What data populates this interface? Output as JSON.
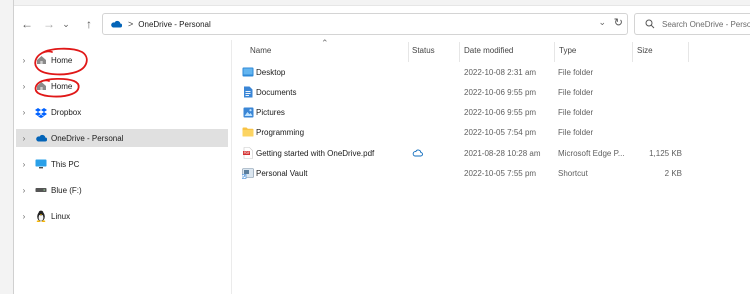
{
  "nav": {
    "back_glyph": "←",
    "forward_glyph": "→",
    "recent_glyph": "⌄",
    "up_glyph": "↑"
  },
  "address": {
    "separator": ">",
    "path": "OneDrive - Personal",
    "dropdown_glyph": "⌄",
    "refresh_glyph": "↻"
  },
  "search": {
    "placeholder": "Search OneDrive - Personal"
  },
  "sidebar": {
    "items": [
      {
        "label": "Home",
        "icon": "home-icon"
      },
      {
        "label": "Home",
        "icon": "home-icon"
      },
      {
        "label": "Dropbox",
        "icon": "dropbox-icon"
      },
      {
        "label": "OneDrive - Personal",
        "icon": "onedrive-cloud-icon",
        "selected": true
      },
      {
        "label": "This PC",
        "icon": "monitor-icon"
      },
      {
        "label": "Blue (F:)",
        "icon": "drive-icon"
      },
      {
        "label": "Linux",
        "icon": "linux-penguin-icon"
      }
    ]
  },
  "columns": {
    "name": "Name",
    "status": "Status",
    "date": "Date modified",
    "type": "Type",
    "size": "Size"
  },
  "files": [
    {
      "name": "Desktop",
      "date": "2022-10-08 2:31 am",
      "type": "File folder",
      "size": "",
      "icon": "desktop-folder-icon",
      "status": ""
    },
    {
      "name": "Documents",
      "date": "2022-10-06 9:55 pm",
      "type": "File folder",
      "size": "",
      "icon": "documents-folder-icon",
      "status": ""
    },
    {
      "name": "Pictures",
      "date": "2022-10-06 9:55 pm",
      "type": "File folder",
      "size": "",
      "icon": "pictures-folder-icon",
      "status": ""
    },
    {
      "name": "Programming",
      "date": "2022-10-05 7:54 pm",
      "type": "File folder",
      "size": "",
      "icon": "folder-icon",
      "status": ""
    },
    {
      "name": "Getting started with OneDrive.pdf",
      "date": "2021-08-28 10:28 am",
      "type": "Microsoft Edge P...",
      "size": "1,125 KB",
      "icon": "pdf-file-icon",
      "status": "cloud-available-icon"
    },
    {
      "name": "Personal Vault",
      "date": "2022-10-05 7:55 pm",
      "type": "Shortcut",
      "size": "2 KB",
      "icon": "vault-shortcut-icon",
      "status": ""
    }
  ],
  "colors": {
    "accent": "#0f6cbd",
    "onedrive_blue": "#0364b8",
    "folder_yellow": "#f8c346",
    "annotation_red": "#e01818",
    "selection": "#e0e0e0"
  }
}
